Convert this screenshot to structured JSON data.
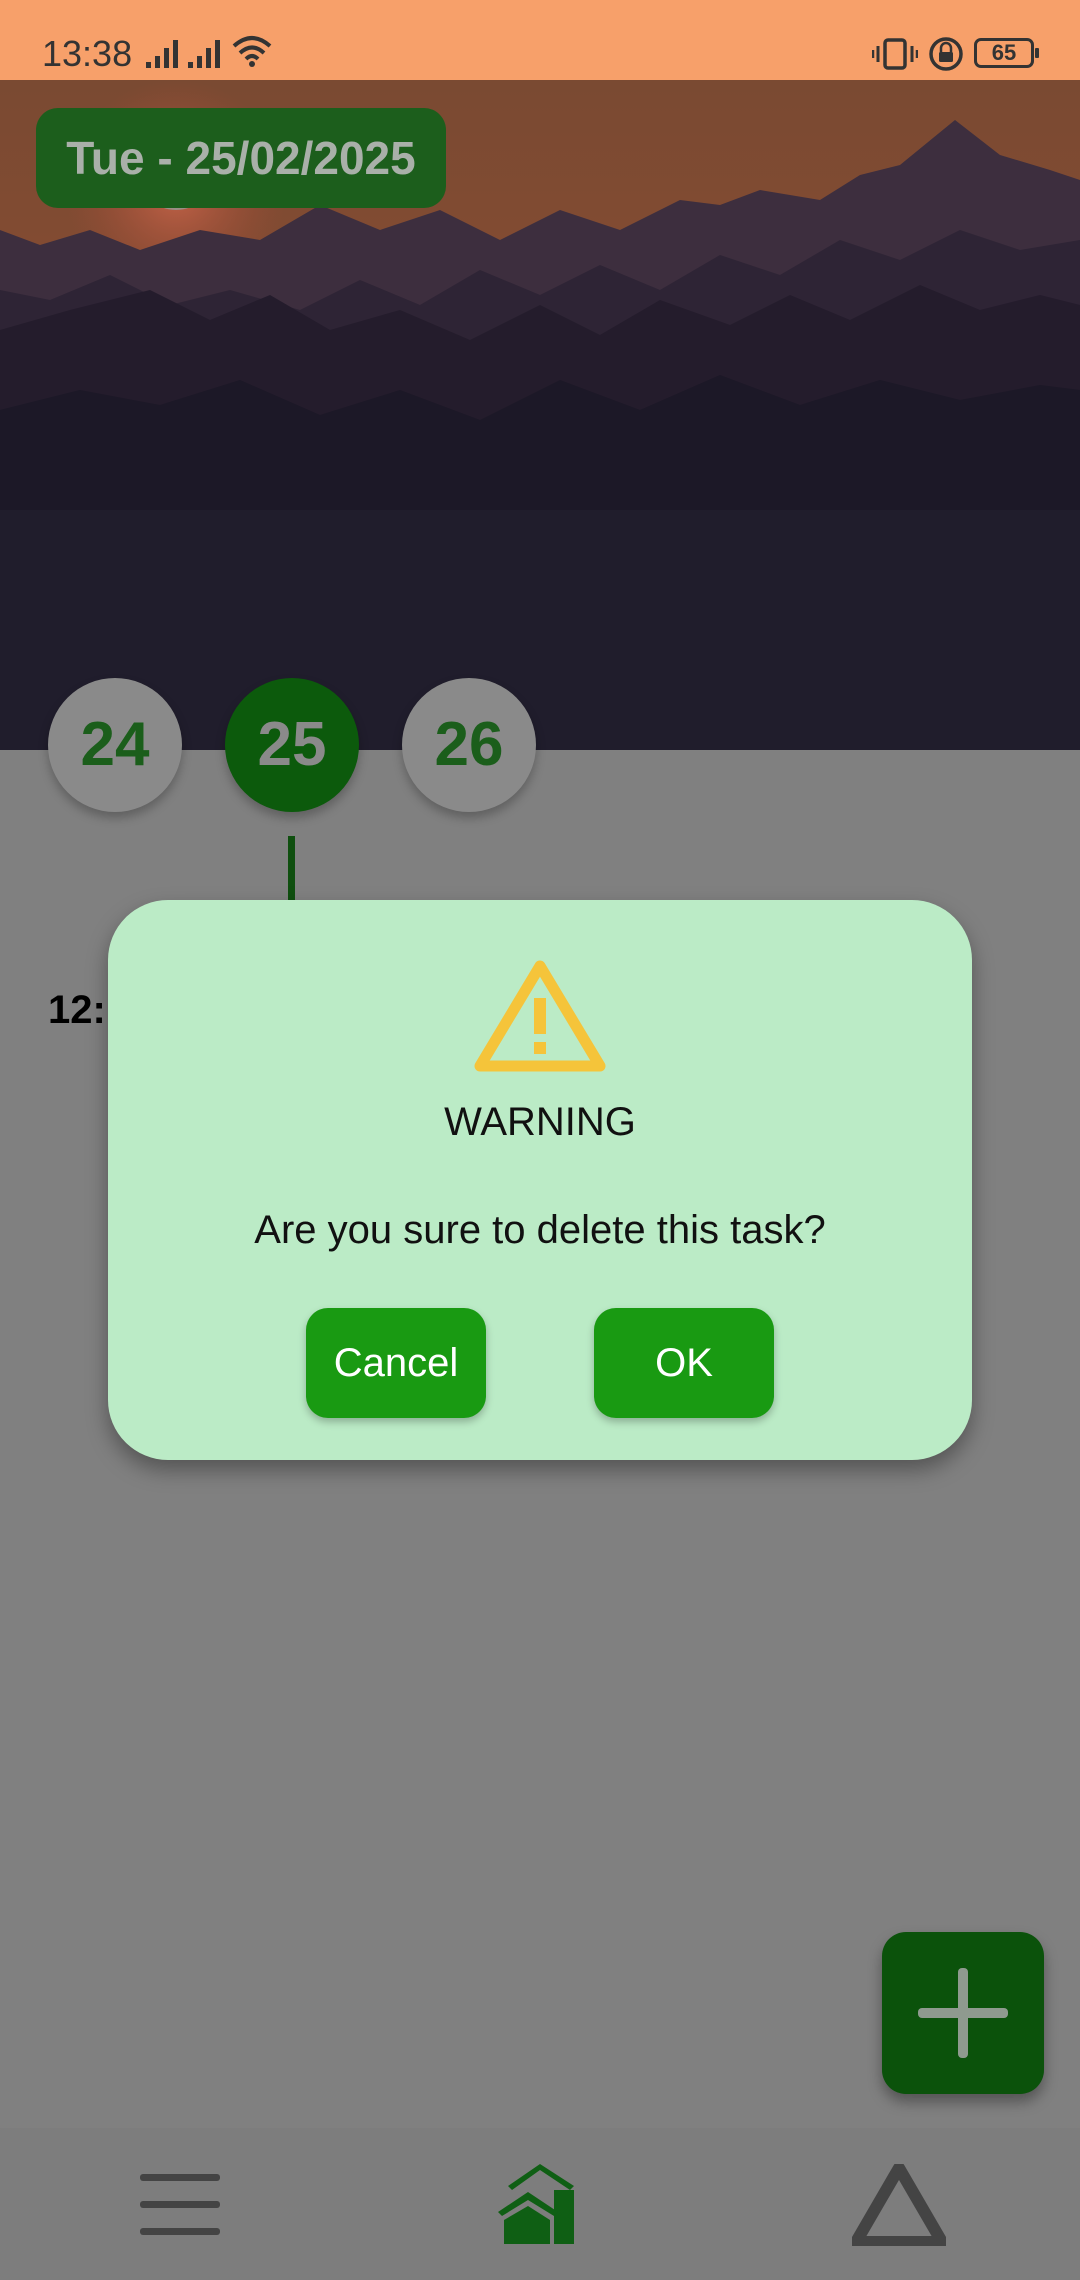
{
  "status_bar": {
    "time": "13:38",
    "battery": "65",
    "icons": [
      "signal-icon",
      "signal-icon",
      "wifi-icon",
      "vibrate-icon",
      "lock-rotation-icon",
      "battery-icon"
    ]
  },
  "header": {
    "date_label": "Tue - 25/02/2025"
  },
  "days": [
    {
      "label": "24",
      "selected": false
    },
    {
      "label": "25",
      "selected": true
    },
    {
      "label": "26",
      "selected": false
    }
  ],
  "timeline": {
    "time_label_visible": "12:"
  },
  "dialog": {
    "icon": "warning-icon",
    "title": "WARNING",
    "message": "Are you sure to delete this task?",
    "cancel_label": "Cancel",
    "ok_label": "OK"
  },
  "fab": {
    "icon": "plus-icon"
  },
  "bottom_nav": {
    "items": [
      {
        "icon": "menu-icon"
      },
      {
        "icon": "home-icon",
        "active": true
      },
      {
        "icon": "triangle-logo-icon"
      }
    ]
  },
  "colors": {
    "status_bar": "#f7a06a",
    "accent_green": "#199a12",
    "dark_green": "#0c5a0c",
    "dialog_bg": "#bbebc6",
    "warning_yellow": "#f5c43a",
    "overlay_gray": "#808080"
  }
}
